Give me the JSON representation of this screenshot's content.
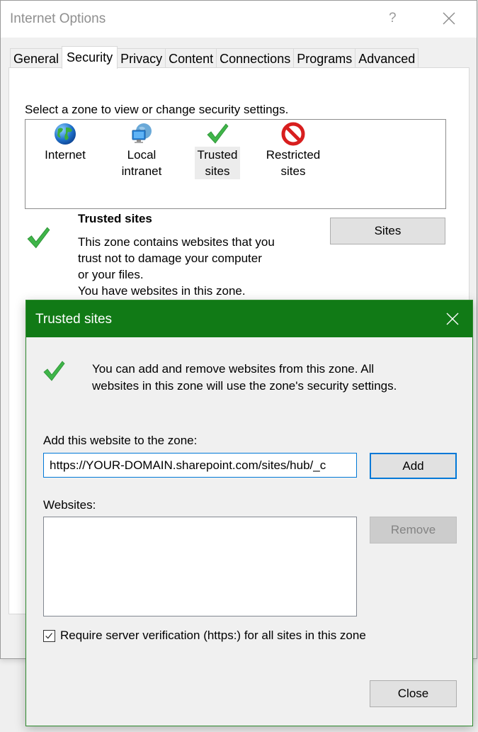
{
  "window": {
    "title": "Internet Options",
    "help_label": "?",
    "close_icon": "close-icon"
  },
  "tabs": [
    {
      "label": "General",
      "active": false
    },
    {
      "label": "Security",
      "active": true
    },
    {
      "label": "Privacy",
      "active": false
    },
    {
      "label": "Content",
      "active": false
    },
    {
      "label": "Connections",
      "active": false
    },
    {
      "label": "Programs",
      "active": false
    },
    {
      "label": "Advanced",
      "active": false
    }
  ],
  "security": {
    "zone_prompt": "Select a zone to view or change security settings.",
    "zones": [
      {
        "line1": "Internet",
        "line2": "",
        "icon": "globe-icon",
        "selected": false
      },
      {
        "line1": "Local",
        "line2": "intranet",
        "icon": "local-intranet-icon",
        "selected": false
      },
      {
        "line1": "Trusted",
        "line2": "sites",
        "icon": "checkmark-icon",
        "selected": true
      },
      {
        "line1": "Restricted",
        "line2": "sites",
        "icon": "restricted-icon",
        "selected": false
      }
    ],
    "selected_zone_title": "Trusted sites",
    "selected_zone_desc": [
      "This zone contains websites that you",
      "trust not to damage your computer",
      "or your files.",
      "You have websites in this zone."
    ],
    "sites_button": "Sites"
  },
  "dialog": {
    "title": "Trusted sites",
    "message_line1": "You can add and remove websites from this zone. All",
    "message_line2": "websites in this zone will use the zone's security settings.",
    "add_label": "Add this website to the zone:",
    "url_value": "https://YOUR-DOMAIN.sharepoint.com/sites/hub/_c",
    "add_button": "Add",
    "websites_label": "Websites:",
    "websites": [],
    "remove_button": "Remove",
    "require_verification_label": "Require server verification (https:) for all sites in this zone",
    "require_verification_checked": true,
    "close_button": "Close",
    "accent_color": "#117a16"
  }
}
